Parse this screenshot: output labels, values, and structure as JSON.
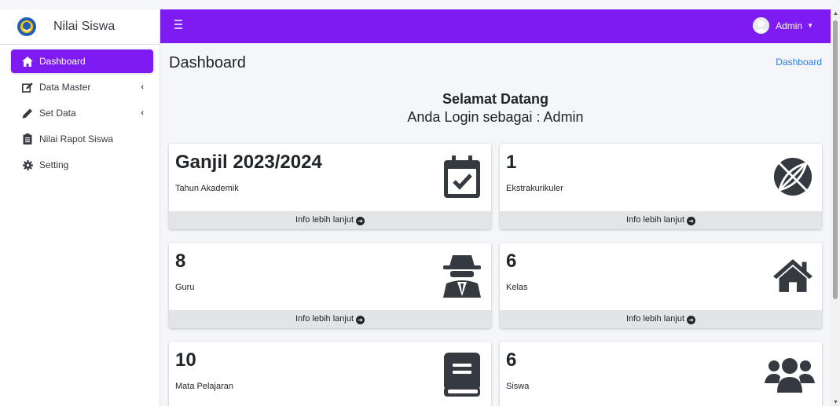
{
  "app": {
    "brand": "Nilai Siswa"
  },
  "sidebar": {
    "items": [
      {
        "label": "Dashboard",
        "icon": "home-icon",
        "active": true,
        "has_caret": false
      },
      {
        "label": "Data Master",
        "icon": "edit-icon",
        "active": false,
        "has_caret": true
      },
      {
        "label": "Set Data",
        "icon": "pencil-icon",
        "active": false,
        "has_caret": true
      },
      {
        "label": "Nilai Rapot Siswa",
        "icon": "clipboard-icon",
        "active": false,
        "has_caret": false
      },
      {
        "label": "Setting",
        "icon": "gear-icon",
        "active": false,
        "has_caret": false
      }
    ]
  },
  "header": {
    "user_name": "Admin"
  },
  "page": {
    "title": "Dashboard",
    "breadcrumb": "Dashboard"
  },
  "welcome": {
    "title": "Selamat Datang",
    "subtitle": "Anda Login sebagai : Admin"
  },
  "boxes": [
    {
      "value": "Ganjil 2023/2024",
      "label": "Tahun Akademik",
      "icon": "calendar-check-icon",
      "footer": "Info lebih lanjut"
    },
    {
      "value": "1",
      "label": "Ekstrakurikuler",
      "icon": "basketball-icon",
      "footer": "Info lebih lanjut"
    },
    {
      "value": "8",
      "label": "Guru",
      "icon": "user-secret-icon",
      "footer": "Info lebih lanjut"
    },
    {
      "value": "6",
      "label": "Kelas",
      "icon": "home-icon",
      "footer": "Info lebih lanjut"
    },
    {
      "value": "10",
      "label": "Mata Pelajaran",
      "icon": "book-icon",
      "footer": ""
    },
    {
      "value": "6",
      "label": "Siswa",
      "icon": "users-icon",
      "footer": ""
    }
  ],
  "colors": {
    "accent": "#7d1bf2",
    "link": "#2b7de9",
    "background": "#f4f6f9"
  }
}
